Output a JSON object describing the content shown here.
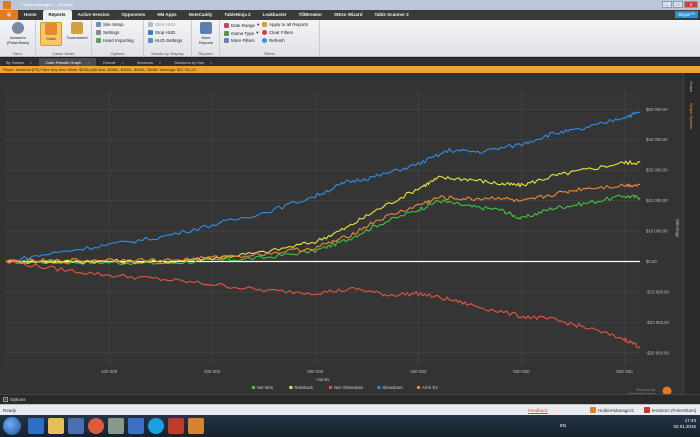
{
  "window": {
    "title": "HoldemManager 2 - Reports"
  },
  "menu": {
    "file_label": "",
    "tabs": [
      "Home",
      "Reports",
      "Active Session",
      "Opponents",
      "HM Apps",
      "NoteCaddy",
      "TableNinja 2",
      "Leakbuster",
      "TiltBreaker",
      "SNGo Wizard",
      "Table Scanner 2"
    ],
    "active": "Reports"
  },
  "skype": {
    "label": "Skype™"
  },
  "ribbon": {
    "hero": {
      "name": "lessstom",
      "site": "(PokerStars)",
      "group": "Hero"
    },
    "game_mode": {
      "cash": "Cash",
      "tournament": "Tournament",
      "group": "Game Mode"
    },
    "options": {
      "items": [
        "Site Setup",
        "Settings",
        "Hand Importing"
      ],
      "group": "Options"
    },
    "hud": {
      "items": [
        "Start HUD",
        "Stop HUD",
        "HUD Settings"
      ],
      "group": "Heads-Up Display"
    },
    "reports": {
      "more_reports": "More Reports",
      "group": "Reports"
    },
    "filters": {
      "items": [
        "Date Range",
        "Game Type",
        "More Filters"
      ],
      "apply_all": "Apply to all Reports",
      "clear": "Clear Filters",
      "refresh": "Refresh",
      "group": "Filters"
    }
  },
  "report_tabs": [
    {
      "label": "By Stakes",
      "active": false
    },
    {
      "label": "Cash Results Graph",
      "active": true
    },
    {
      "label": "Overall",
      "active": false
    },
    {
      "label": "Sessions",
      "active": false
    },
    {
      "label": "Sessions by Day",
      "active": false
    }
  ],
  "filter_bar": {
    "text": "Player: lessstom (PS)  Filter: Any desc Mode: $20NL(6)6 Max, $25NL, $30NL, $40NL, $40NL  Winnings: $31 911,00"
  },
  "side_panel": {
    "items": [
      "Graph",
      "Graph Options"
    ],
    "active": "Graph Options"
  },
  "chart_data": {
    "type": "line",
    "xlabel": "Hands",
    "ylabel": "Winnings",
    "x_ticks": [
      "100 000",
      "200 000",
      "300 000",
      "400 000",
      "500 000",
      "600 000"
    ],
    "x_tick_values": [
      100000,
      200000,
      300000,
      400000,
      500000,
      600000
    ],
    "xlim": [
      0,
      615000
    ],
    "y_ticks": [
      "$50 000,00",
      "$40 000,00",
      "$30 000,00",
      "$20 000,00",
      "$10 000,00",
      "$0,00",
      "-$10 000,00",
      "-$20 000,00",
      "-$30 000,00"
    ],
    "y_tick_values": [
      50000,
      40000,
      30000,
      20000,
      10000,
      0,
      -10000,
      -20000,
      -30000
    ],
    "ylim": [
      -34000,
      56000
    ],
    "grid": true,
    "legend_position": "bottom-center",
    "series": [
      {
        "name": "Net Won",
        "color": "#3fc43f",
        "x": [
          0,
          50000,
          100000,
          150000,
          200000,
          250000,
          300000,
          330000,
          360000,
          400000,
          420000,
          450000,
          480000,
          500000,
          530000,
          560000,
          600000,
          615000
        ],
        "y": [
          0,
          -200,
          -300,
          -600,
          300,
          1200,
          3500,
          7000,
          12000,
          17000,
          20000,
          18000,
          17000,
          14000,
          17500,
          19000,
          21500,
          21000
        ]
      },
      {
        "name": "Rakeback",
        "color": "#e7e63b",
        "x": [
          0,
          50000,
          100000,
          150000,
          200000,
          250000,
          300000,
          330000,
          360000,
          400000,
          420000,
          450000,
          480000,
          500000,
          530000,
          560000,
          600000,
          615000
        ],
        "y": [
          0,
          -100,
          100,
          -200,
          1200,
          3000,
          6500,
          11000,
          17000,
          24000,
          27500,
          27000,
          25500,
          25000,
          28000,
          30000,
          32500,
          32500
        ]
      },
      {
        "name": "Non Showdown",
        "color": "#e8553c",
        "x": [
          0,
          50000,
          100000,
          150000,
          200000,
          250000,
          300000,
          340000,
          370000,
          400000,
          430000,
          460000,
          500000,
          530000,
          560000,
          600000,
          615000
        ],
        "y": [
          0,
          -2500,
          -4500,
          -5800,
          -7500,
          -9500,
          -10300,
          -9000,
          -11000,
          -10500,
          -12500,
          -15000,
          -18000,
          -19000,
          -21500,
          -25500,
          -28000
        ]
      },
      {
        "name": "Showdown",
        "color": "#2f8fe6",
        "x": [
          0,
          50000,
          100000,
          150000,
          200000,
          250000,
          300000,
          330000,
          360000,
          400000,
          430000,
          460000,
          500000,
          530000,
          560000,
          600000,
          615000
        ],
        "y": [
          0,
          3000,
          5500,
          8000,
          12000,
          16000,
          21500,
          26000,
          28000,
          32000,
          36500,
          36000,
          38500,
          42000,
          43500,
          47500,
          49000
        ]
      },
      {
        "name": "All-in EV",
        "color": "#ea8a36",
        "x": [
          0,
          50000,
          100000,
          150000,
          200000,
          250000,
          300000,
          330000,
          360000,
          400000,
          420000,
          450000,
          480000,
          500000,
          530000,
          560000,
          600000,
          615000
        ],
        "y": [
          0,
          200,
          600,
          300,
          1200,
          2500,
          4500,
          8000,
          13500,
          18500,
          21000,
          20500,
          21000,
          19500,
          22000,
          24000,
          25000,
          25200
        ]
      }
    ]
  },
  "watermark": {
    "line1": "Powered by",
    "line2": "HoldemManager"
  },
  "options_bar": {
    "label": "Options"
  },
  "status": {
    "ready": "Ready",
    "feedback": "Feedback",
    "version": "HoldemManager2",
    "account": "lessstom (PokerStars)"
  },
  "taskbar": {
    "lang": "EN",
    "time": "17:43",
    "date": "02.01.2015"
  }
}
